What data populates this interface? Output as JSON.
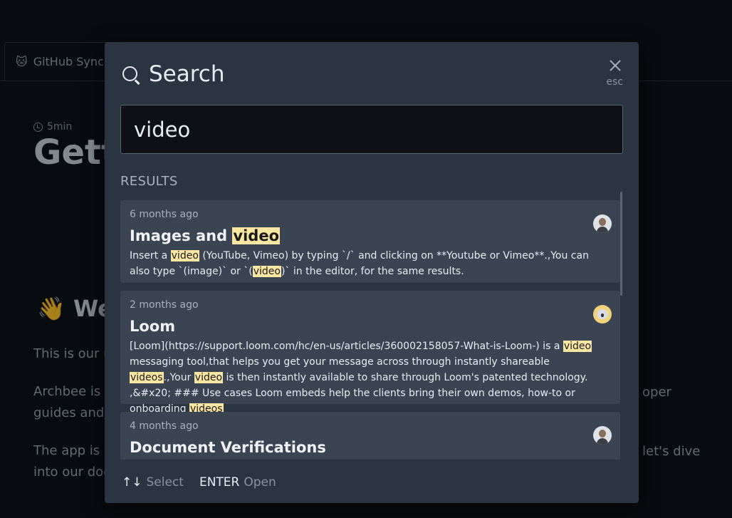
{
  "background": {
    "tab_emoji": "🐱",
    "tab_label": "GitHub Sync",
    "read_time": "5min",
    "page_title_fragment": "Gett",
    "wave_emoji": "👋",
    "heading_fragment": "We",
    "paragraphs": [
      "This is our u",
      "Archbee is a",
      "guides and",
      "The app is r",
      "into our doc"
    ],
    "right_fragments": [
      "oper",
      "let's dive"
    ]
  },
  "modal": {
    "title": "Search",
    "close_hint": "esc",
    "search_value": "video",
    "results_label": "RESULTS",
    "results": [
      {
        "time": "6 months ago",
        "title_parts": [
          "Images and ",
          "video"
        ],
        "snippet_parts": [
          "Insert a ",
          "video",
          " (YouTube, Vimeo) by typing `/` and clicking on **Youtube or Vimeo**.,You can also type `(image)` or `(",
          "video",
          ")` in the editor, for the same results."
        ],
        "avatar": "man-avatar"
      },
      {
        "time": "2 months ago",
        "title_parts": [
          "Loom"
        ],
        "snippet_parts": [
          "[Loom](https://support.loom.com/hc/en-us/articles/360002158057-What-is-Loom-) is a ",
          "video",
          " messaging tool,that helps you get your message across through instantly shareable ",
          "videos",
          ".,Your ",
          "video",
          " is then instantly available to share through Loom's patented technology. ,&#x20; ### Use cases Loom embeds help the clients bring their own demos, how-to or onboarding ",
          "videos"
        ],
        "avatar": "koala-avatar"
      },
      {
        "time": "4 months ago",
        "title_parts": [
          "Document Verifications"
        ],
        "snippet_parts": [],
        "avatar": "man-avatar"
      }
    ],
    "footer": {
      "select_keys": "↑↓",
      "select_label": "Select",
      "open_key": "ENTER",
      "open_label": "Open"
    }
  },
  "colors": {
    "page_background": "#0d1117",
    "modal_background": "#2b3441",
    "card_background": "#3b4453",
    "highlight": "#fbe7a1"
  }
}
